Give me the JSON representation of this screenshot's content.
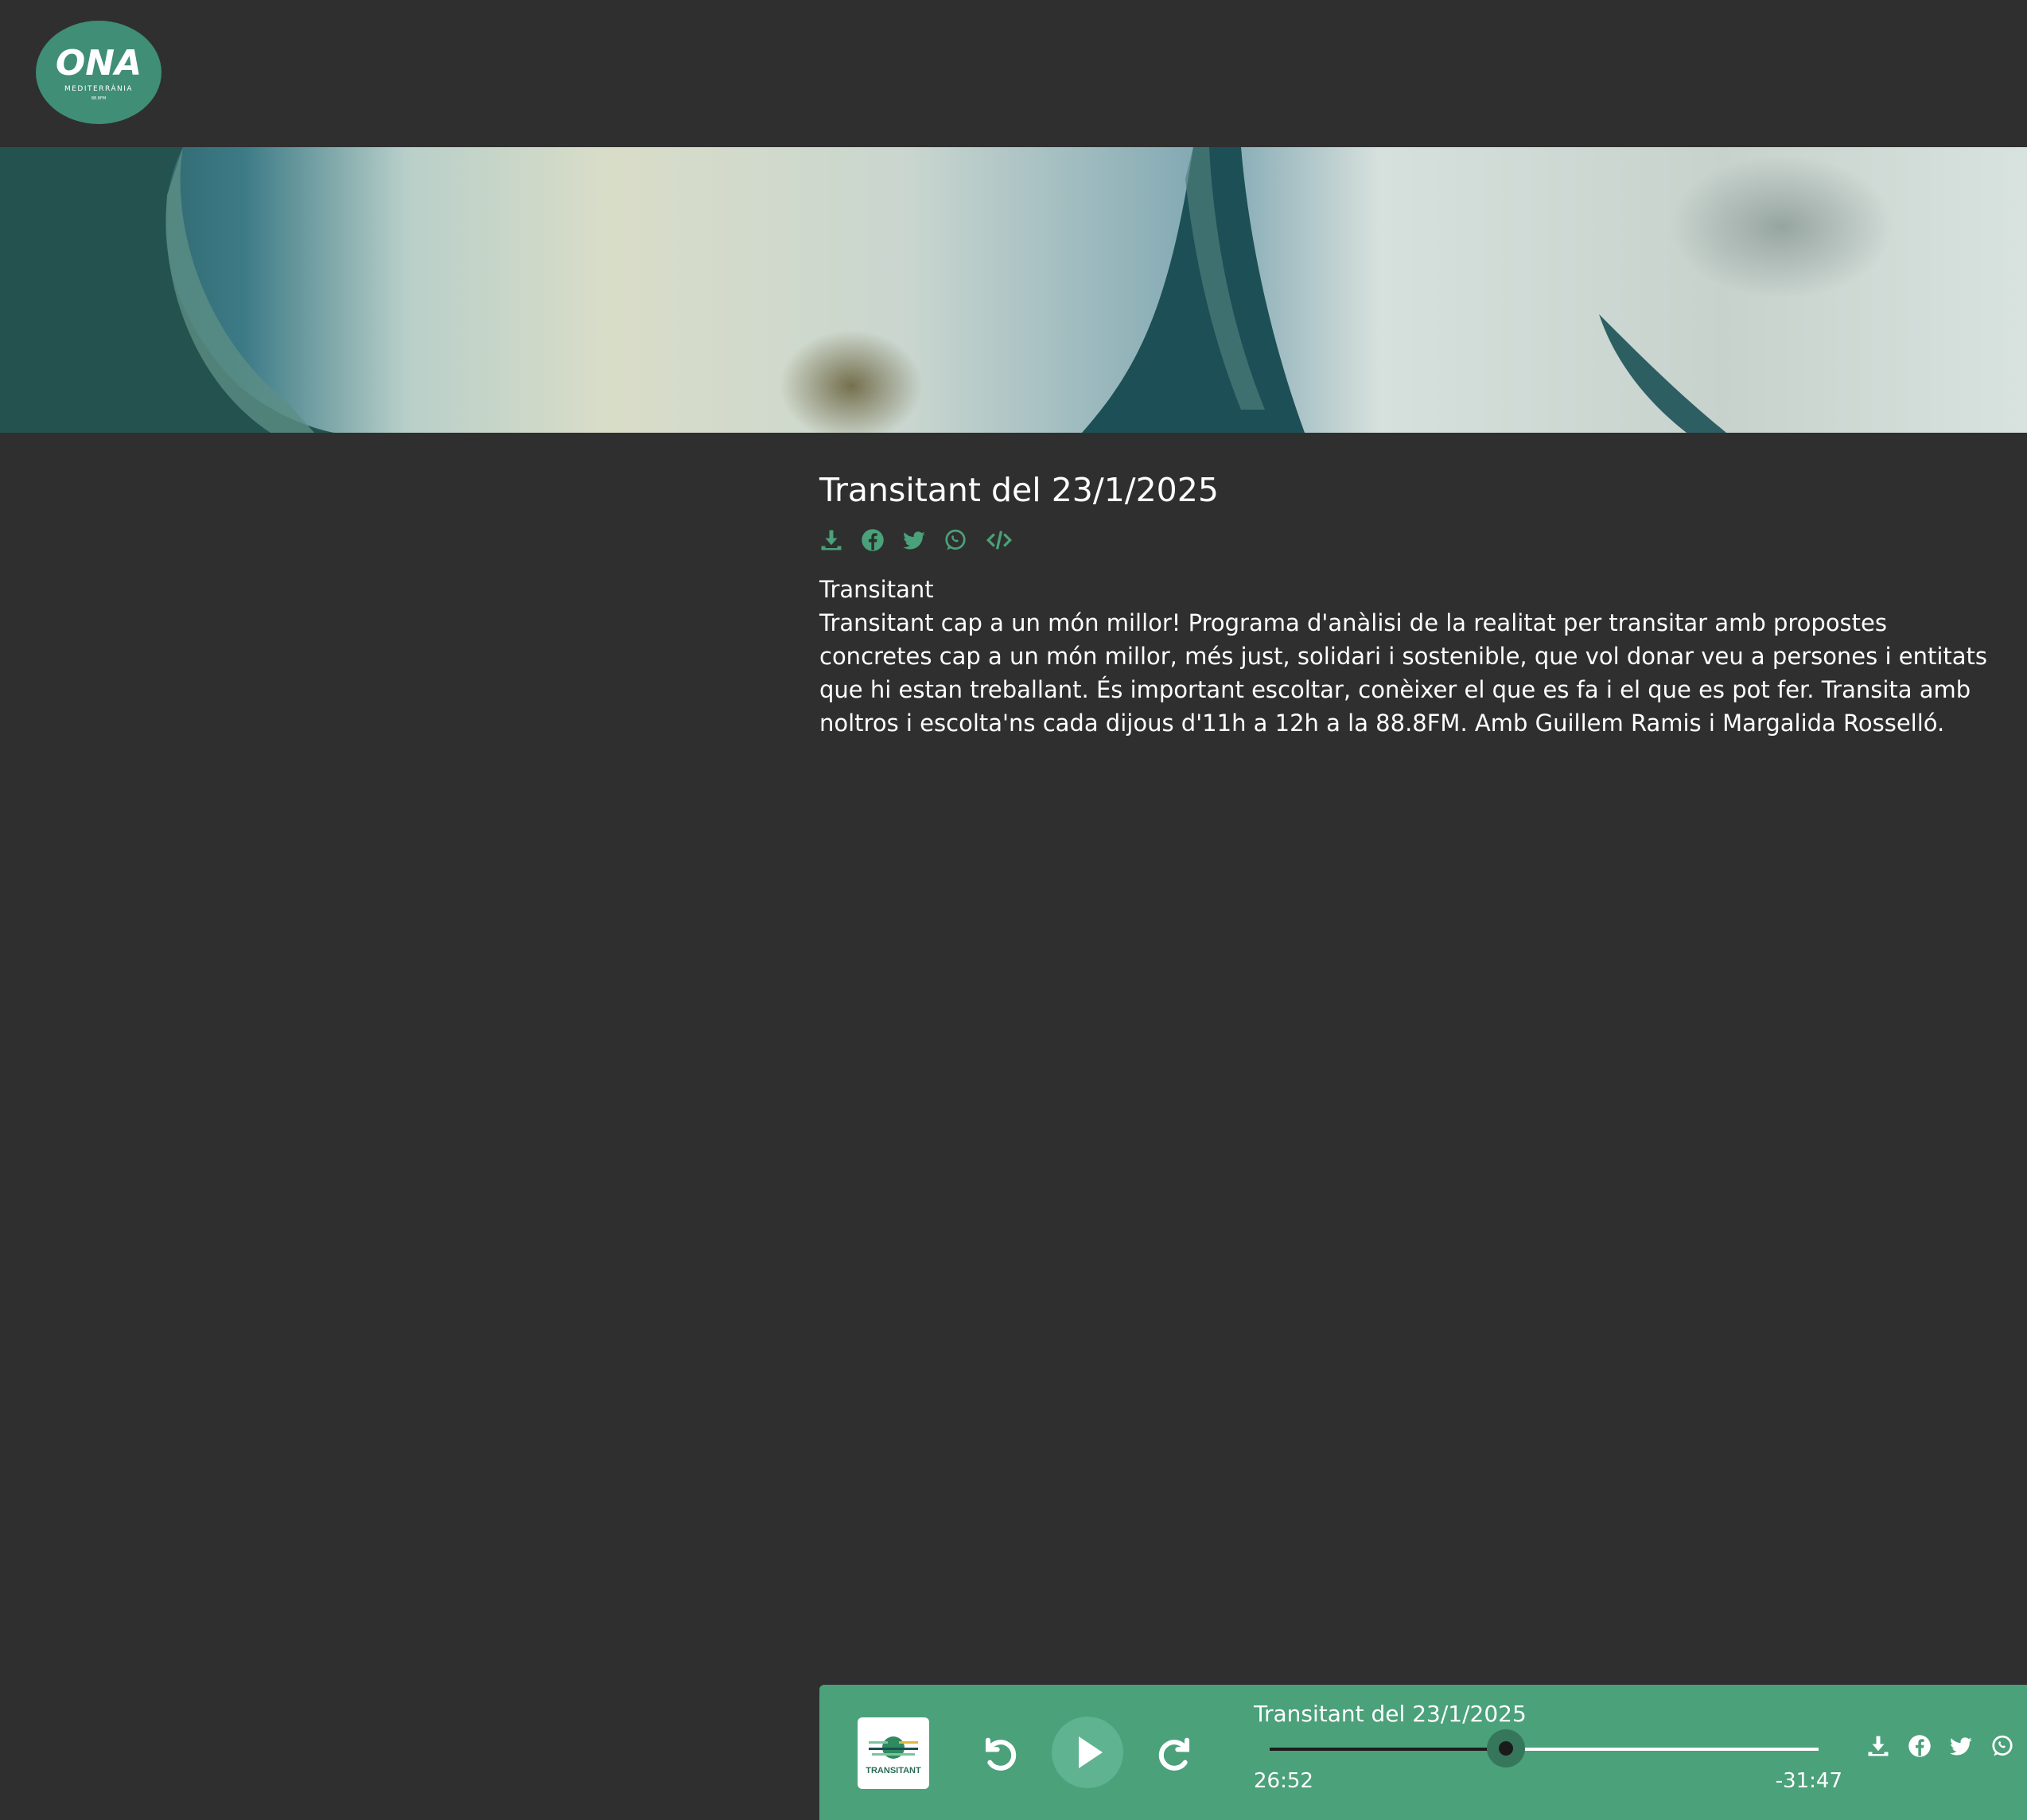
{
  "brand": {
    "logo_text": "ONA",
    "logo_subtext": "MEDITERRÀNIA",
    "logo_freq": "88.8FM",
    "logo_color": "#3f8e75"
  },
  "episode": {
    "title": "Transitant del 23/1/2025",
    "program": "Transitant",
    "description": "Transitant cap a un món millor!  Programa d'anàlisi de la realitat per transitar amb propostes concretes cap a un món millor, més just, solidari i sostenible, que vol donar veu a persones i entitats que hi estan treballant. És important escoltar, conèixer el que es fa i el que es pot fer. Transita amb noltros i escolta'ns cada dijous d'11h a 12h a la 88.8FM.   Amb Guillem Ramis i Margalida Rosselló."
  },
  "share_icons": [
    "download-icon",
    "facebook-icon",
    "twitter-icon",
    "whatsapp-icon",
    "embed-code-icon"
  ],
  "player": {
    "title": "Transitant del 23/1/2025",
    "cover_text": "TRANSITANT",
    "current_time": "26:52",
    "remaining_time": "-31:47",
    "progress": 0.43,
    "bg_color": "#4aa17a",
    "icons": [
      "download-icon",
      "facebook-icon",
      "twitter-icon",
      "whatsapp-icon"
    ]
  },
  "accent_color": "#4aa17a"
}
